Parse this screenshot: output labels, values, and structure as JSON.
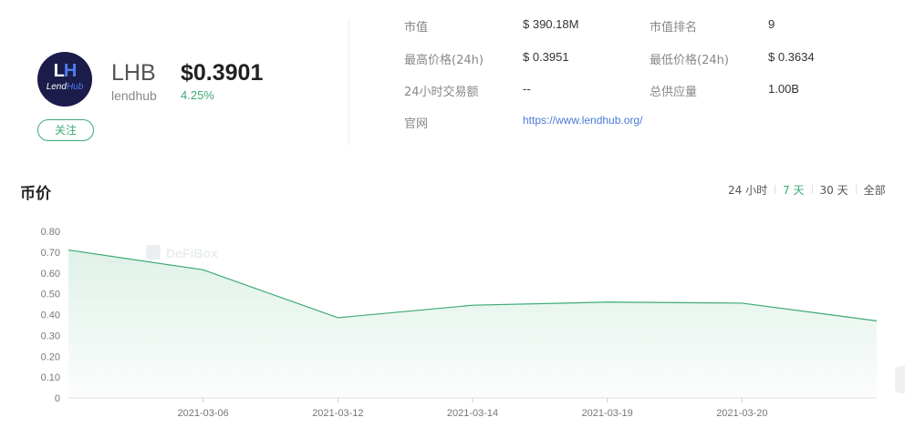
{
  "token": {
    "symbol": "LHB",
    "slug": "lendhub",
    "price": "$0.3901",
    "change": "4.25%",
    "follow_label": "关注",
    "logo": {
      "mark_l": "L",
      "mark_h": "H",
      "word_lend": "Lend",
      "word_hub": "Hub"
    }
  },
  "stats": {
    "market_cap": {
      "label": "市值",
      "value": "$ 390.18M"
    },
    "rank": {
      "label": "市值排名",
      "value": "9"
    },
    "high_24h": {
      "label": "最高价格(24h)",
      "value": "$ 0.3951"
    },
    "low_24h": {
      "label": "最低价格(24h)",
      "value": "$ 0.3634"
    },
    "volume_24h": {
      "label": "24小时交易额",
      "value": "--"
    },
    "supply": {
      "label": "总供应量",
      "value": "1.00B"
    },
    "website": {
      "label": "官网",
      "value": "https://www.lendhub.org/"
    }
  },
  "chart": {
    "title": "币价",
    "ranges": [
      "24 小时",
      "7 天",
      "30 天",
      "全部"
    ],
    "active_range": 1,
    "watermark": "DeFiBox"
  },
  "colors": {
    "accent": "#3daa74",
    "link": "#4a7bd6",
    "logo_bg": "#1b1c4a"
  },
  "chart_data": {
    "type": "area",
    "x": [
      "",
      "2021-03-06",
      "2021-03-12",
      "2021-03-14",
      "2021-03-19",
      "2021-03-20",
      ""
    ],
    "values": [
      0.71,
      0.615,
      0.385,
      0.445,
      0.46,
      0.455,
      0.37
    ],
    "ylim": [
      0,
      0.8
    ],
    "yticks": [
      "0",
      "0.10",
      "0.20",
      "0.30",
      "0.40",
      "0.50",
      "0.60",
      "0.70",
      "0.80"
    ],
    "xticks": [
      "2021-03-06",
      "2021-03-12",
      "2021-03-14",
      "2021-03-19",
      "2021-03-20"
    ],
    "grid": false,
    "color": "#3daa74"
  }
}
